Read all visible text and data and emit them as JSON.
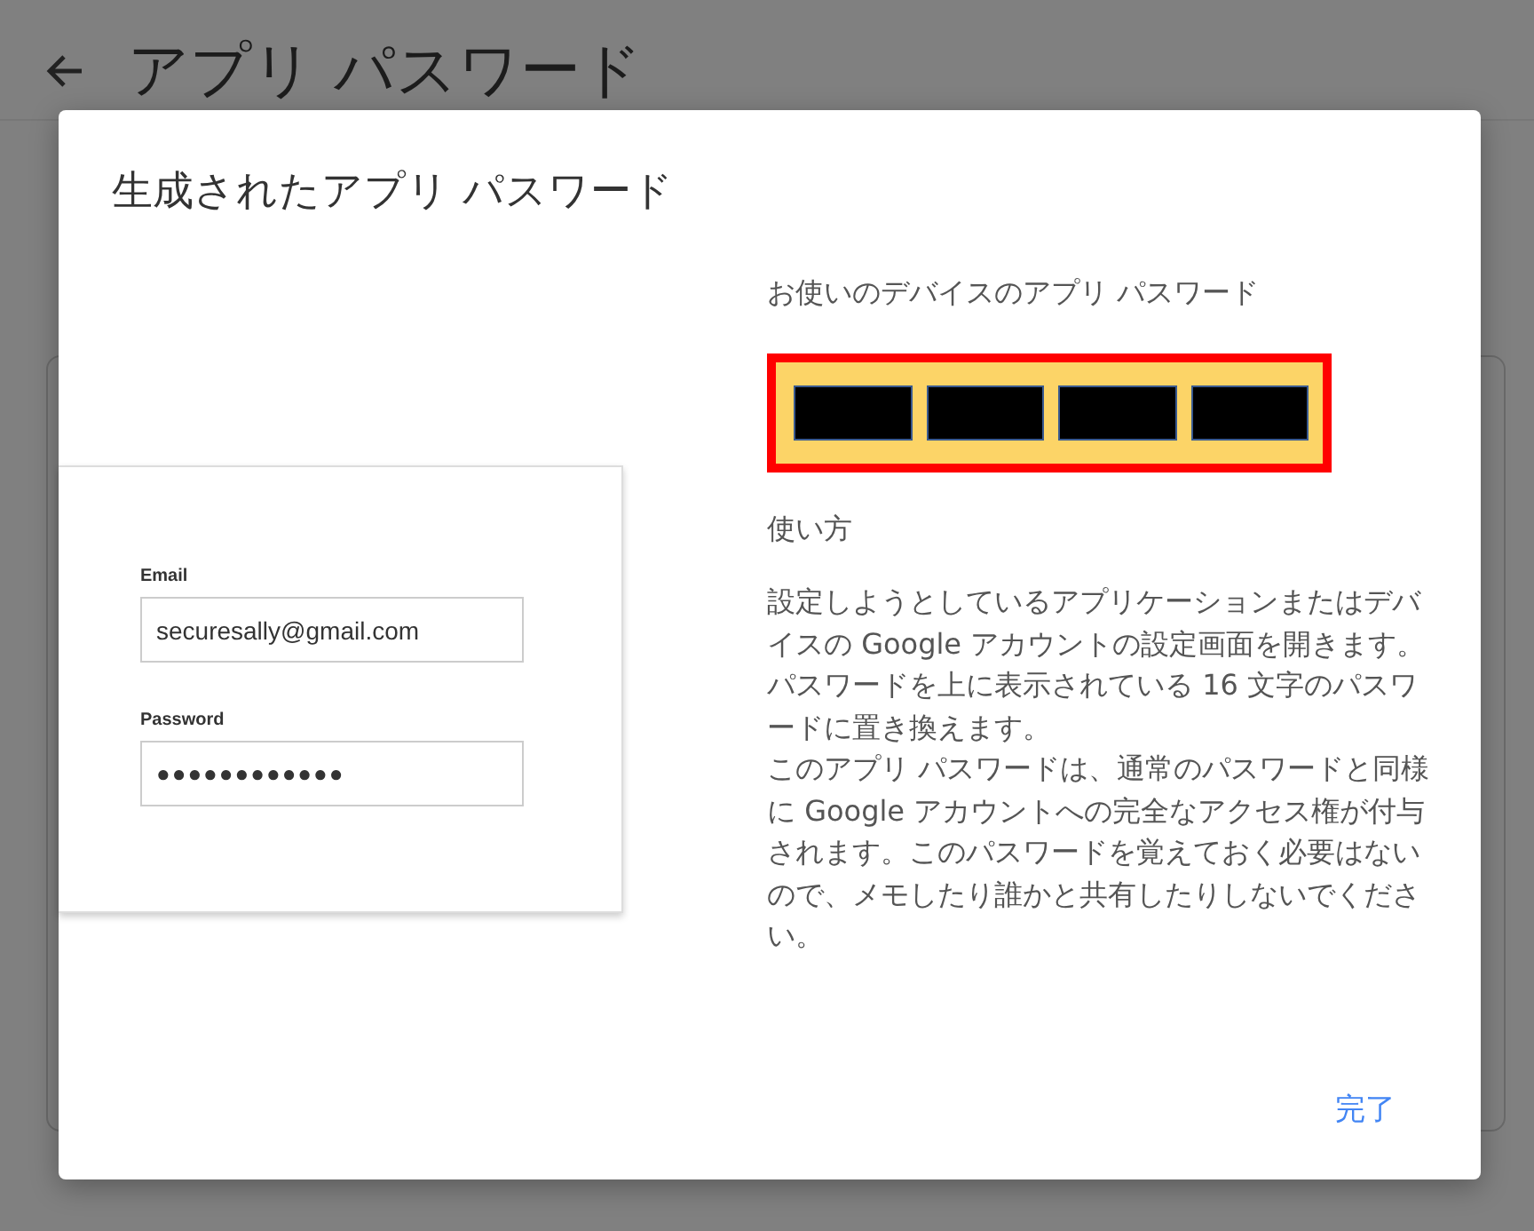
{
  "page": {
    "title": "アプリ パスワード"
  },
  "dialog": {
    "title": "生成されたアプリ パスワード",
    "illustration": {
      "kind": "login-form",
      "email_label": "Email",
      "email_value": "securesally@gmail.com",
      "password_label": "Password",
      "password_value": "●●●●●●●●●●●●"
    },
    "password_heading": "お使いのデバイスのアプリ パスワード",
    "password_blocks": [
      {
        "kind": "redacted"
      },
      {
        "kind": "redacted"
      },
      {
        "kind": "redacted"
      },
      {
        "kind": "redacted"
      }
    ],
    "usage_heading": "使い方",
    "paragraphs": [
      "設定しようとしているアプリケーションまたはデバイスの Google アカウントの設定画面を開きます。パスワードを上に表示されている 16 文字のパスワードに置き換えます。",
      "このアプリ パスワードは、通常のパスワードと同様に Google アカウントへの完全なアクセス権が付与されます。このパスワードを覚えておく必要はないので、メモしたり誰かと共有したりしないでください。"
    ],
    "done_button": "完了"
  }
}
